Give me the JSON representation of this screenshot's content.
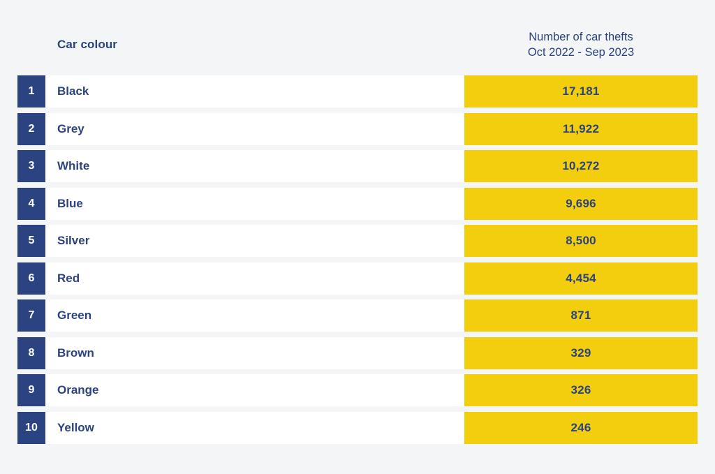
{
  "header": {
    "category_label": "Car colour",
    "value_label_line1": "Number of car thefts",
    "value_label_line2": "Oct 2022 - Sep 2023"
  },
  "colors": {
    "navy": "#2b4380",
    "yellow": "#f2ce0e",
    "background": "#f4f5f7",
    "row_band": "#ffffff"
  },
  "chart_data": {
    "type": "table",
    "title": "",
    "xlabel": "Car colour",
    "ylabel": "Number of car thefts Oct 2022 - Sep 2023",
    "categories": [
      "Black",
      "Grey",
      "White",
      "Blue",
      "Silver",
      "Red",
      "Green",
      "Brown",
      "Orange",
      "Yellow"
    ],
    "values": [
      17181,
      11922,
      10272,
      9696,
      8500,
      4454,
      871,
      329,
      326,
      246
    ],
    "value_labels": [
      "17,181",
      "11,922",
      "10,272",
      "9,696",
      "8,500",
      "4,454",
      "871",
      "329",
      "326",
      "246"
    ],
    "ranks": [
      "1",
      "2",
      "3",
      "4",
      "5",
      "6",
      "7",
      "8",
      "9",
      "10"
    ],
    "legend": [],
    "grid": false,
    "rows": [
      {
        "rank": "1",
        "category": "Black",
        "value": 17181,
        "value_label": "17,181"
      },
      {
        "rank": "2",
        "category": "Grey",
        "value": 11922,
        "value_label": "11,922"
      },
      {
        "rank": "3",
        "category": "White",
        "value": 10272,
        "value_label": "10,272"
      },
      {
        "rank": "4",
        "category": "Blue",
        "value": 9696,
        "value_label": "9,696"
      },
      {
        "rank": "5",
        "category": "Silver",
        "value": 8500,
        "value_label": "8,500"
      },
      {
        "rank": "6",
        "category": "Red",
        "value": 4454,
        "value_label": "4,454"
      },
      {
        "rank": "7",
        "category": "Green",
        "value": 871,
        "value_label": "871"
      },
      {
        "rank": "8",
        "category": "Brown",
        "value": 329,
        "value_label": "329"
      },
      {
        "rank": "9",
        "category": "Orange",
        "value": 326,
        "value_label": "326"
      },
      {
        "rank": "10",
        "category": "Yellow",
        "value": 246,
        "value_label": "246"
      }
    ]
  }
}
